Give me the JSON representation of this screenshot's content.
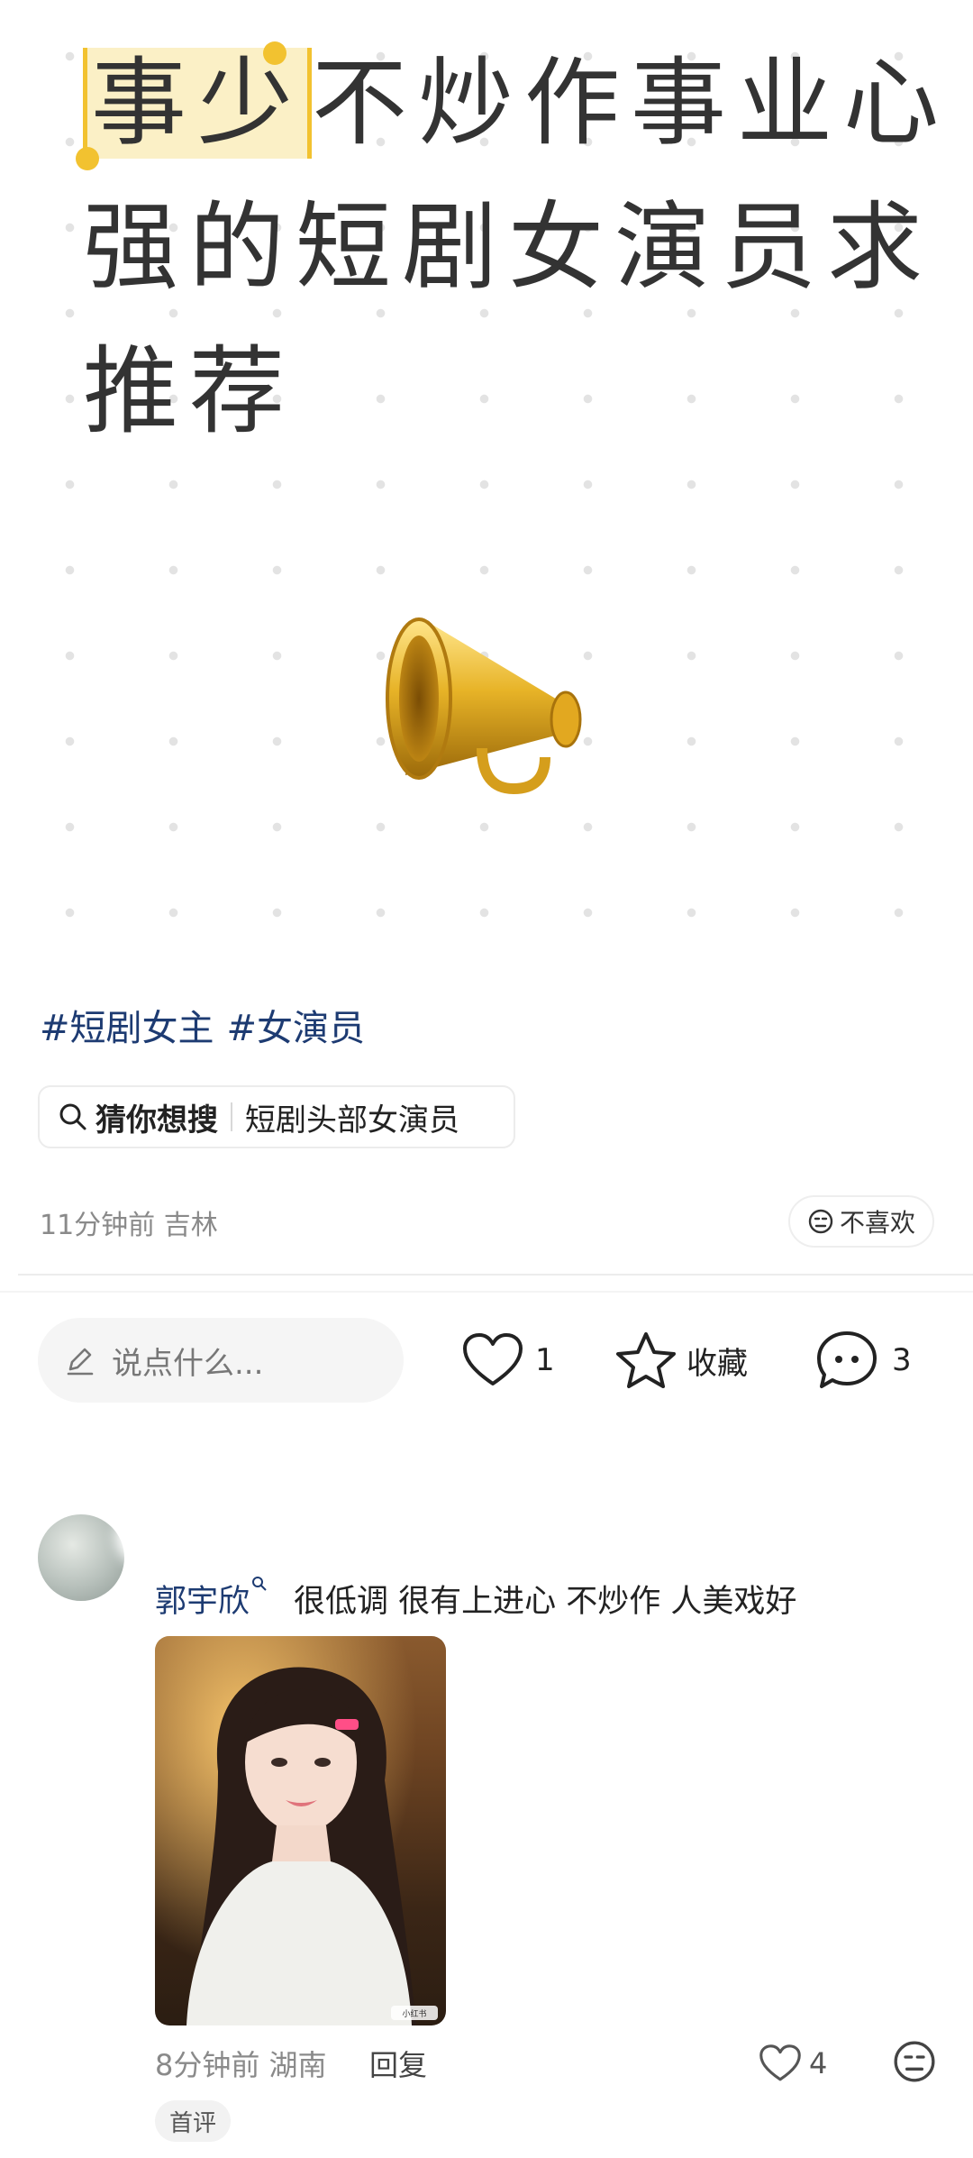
{
  "hero": {
    "line1_highlight": "事少",
    "line1_rest": "不炒作事业心",
    "line2": "强的短剧女演员求",
    "line3": "推荐",
    "emoji": "📯"
  },
  "tags": [
    "#短剧女主",
    "#女演员"
  ],
  "suggest": {
    "label": "猜你想搜",
    "query": "短剧头部女演员"
  },
  "meta": {
    "time_location": "11分钟前 吉林",
    "dislike_label": "不喜欢"
  },
  "actions": {
    "comment_placeholder": "说点什么...",
    "likes": "1",
    "collect_label": "收藏",
    "comments": "3"
  },
  "comment": {
    "author": "郭宇欣",
    "text": "很低调 很有上进心 不炒作 人美戏好",
    "time_location": "8分钟前 湖南",
    "reply_label": "回复",
    "likes": "4",
    "badge": "首评",
    "photo_watermark": "小红书"
  }
}
